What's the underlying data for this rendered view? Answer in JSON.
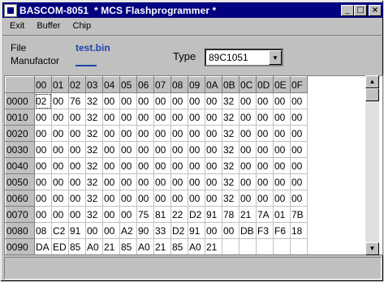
{
  "window": {
    "title": "BASCOM-8051  * MCS Flashprogrammer *",
    "minimize": "_",
    "maximize": "□",
    "close": "×"
  },
  "menu": [
    "Exit",
    "Buffer",
    "Chip"
  ],
  "info": {
    "file_label": "File",
    "file_value": "test.bin",
    "manufactor_label": "Manufactor",
    "type_label": "Type",
    "type_value": "89C1051"
  },
  "grid": {
    "columns": [
      "00",
      "01",
      "02",
      "03",
      "04",
      "05",
      "06",
      "07",
      "08",
      "09",
      "0A",
      "0B",
      "0C",
      "0D",
      "0E",
      "0F"
    ],
    "rows": [
      {
        "addr": "0000",
        "cells": [
          "02",
          "00",
          "76",
          "32",
          "00",
          "00",
          "00",
          "00",
          "00",
          "00",
          "00",
          "32",
          "00",
          "00",
          "00",
          "00"
        ]
      },
      {
        "addr": "0010",
        "cells": [
          "00",
          "00",
          "00",
          "32",
          "00",
          "00",
          "00",
          "00",
          "00",
          "00",
          "00",
          "32",
          "00",
          "00",
          "00",
          "00"
        ]
      },
      {
        "addr": "0020",
        "cells": [
          "00",
          "00",
          "00",
          "32",
          "00",
          "00",
          "00",
          "00",
          "00",
          "00",
          "00",
          "32",
          "00",
          "00",
          "00",
          "00"
        ]
      },
      {
        "addr": "0030",
        "cells": [
          "00",
          "00",
          "00",
          "32",
          "00",
          "00",
          "00",
          "00",
          "00",
          "00",
          "00",
          "32",
          "00",
          "00",
          "00",
          "00"
        ]
      },
      {
        "addr": "0040",
        "cells": [
          "00",
          "00",
          "00",
          "32",
          "00",
          "00",
          "00",
          "00",
          "00",
          "00",
          "00",
          "32",
          "00",
          "00",
          "00",
          "00"
        ]
      },
      {
        "addr": "0050",
        "cells": [
          "00",
          "00",
          "00",
          "32",
          "00",
          "00",
          "00",
          "00",
          "00",
          "00",
          "00",
          "32",
          "00",
          "00",
          "00",
          "00"
        ]
      },
      {
        "addr": "0060",
        "cells": [
          "00",
          "00",
          "00",
          "32",
          "00",
          "00",
          "00",
          "00",
          "00",
          "00",
          "00",
          "32",
          "00",
          "00",
          "00",
          "00"
        ]
      },
      {
        "addr": "0070",
        "cells": [
          "00",
          "00",
          "00",
          "32",
          "00",
          "00",
          "75",
          "81",
          "22",
          "D2",
          "91",
          "78",
          "21",
          "7A",
          "01",
          "7B"
        ]
      },
      {
        "addr": "0080",
        "cells": [
          "08",
          "C2",
          "91",
          "00",
          "00",
          "A2",
          "90",
          "33",
          "D2",
          "91",
          "00",
          "00",
          "DB",
          "F3",
          "F6",
          "18"
        ]
      },
      {
        "addr": "0090",
        "cells": [
          "DA",
          "ED",
          "85",
          "A0",
          "21",
          "85",
          "A0",
          "21",
          "85",
          "A0",
          "21",
          "",
          "",
          "",
          "",
          ""
        ]
      }
    ]
  },
  "scroll": {
    "up": "▲",
    "down": "▼"
  },
  "select_arrow": "▼",
  "status_text": ""
}
